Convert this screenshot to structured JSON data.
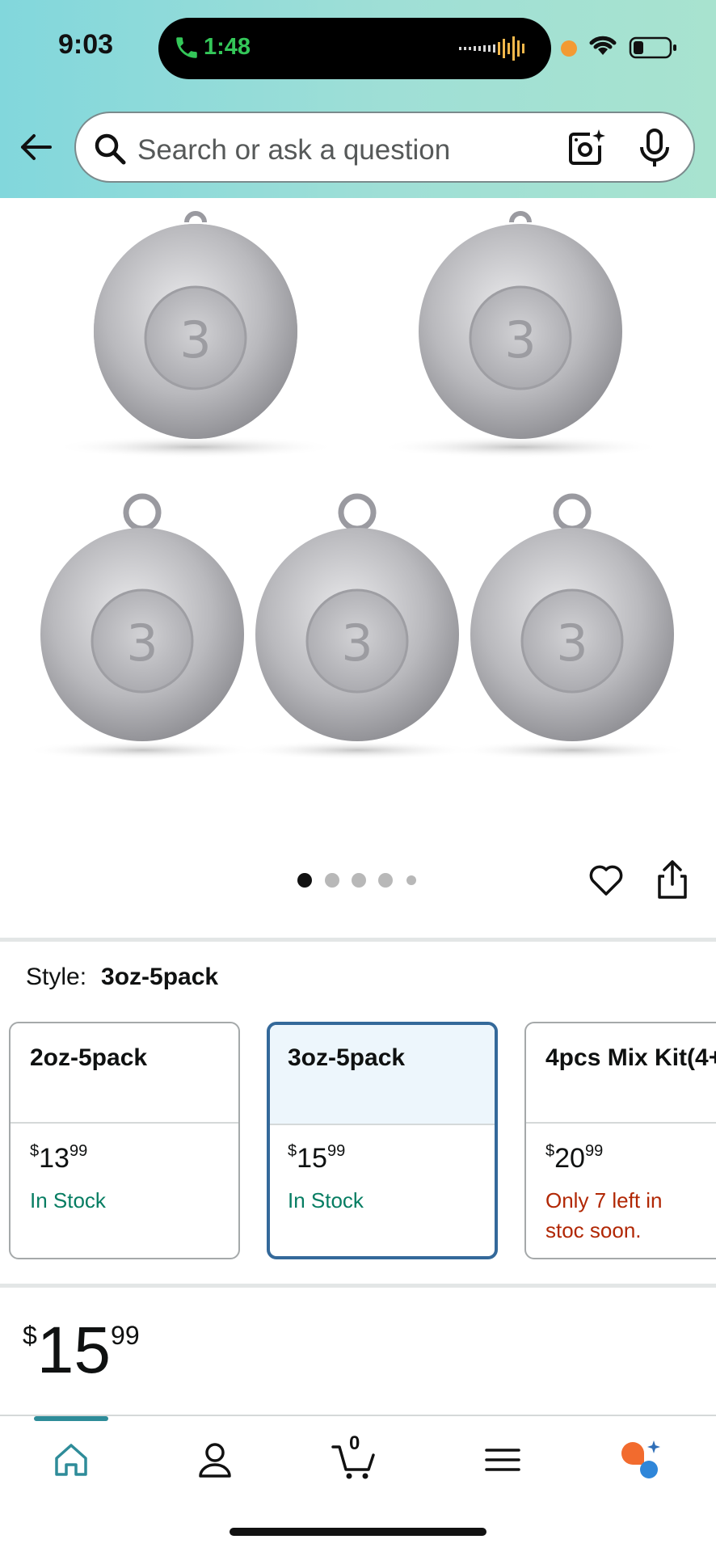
{
  "status_bar": {
    "time": "9:03",
    "call_duration": "1:48"
  },
  "header": {
    "search_placeholder": "Search or ask a question"
  },
  "product_image": {
    "weight_marking": "3",
    "carousel_count": 5,
    "carousel_active": 1
  },
  "style_selector": {
    "label": "Style:",
    "selected_value": "3oz-5pack",
    "options": [
      {
        "name": "2oz-5pack",
        "price_dollars": "13",
        "price_cents": "99",
        "currency": "$",
        "stock": "In Stock"
      },
      {
        "name": "3oz-5pack",
        "price_dollars": "15",
        "price_cents": "99",
        "currency": "$",
        "stock": "In Stock"
      },
      {
        "name": "4pcs Mix Kit(4+",
        "price_dollars": "20",
        "price_cents": "99",
        "currency": "$",
        "stock": "Only 7 left in stoc soon."
      }
    ]
  },
  "price": {
    "currency": "$",
    "dollars": "15",
    "cents": "99"
  },
  "bottom_nav": {
    "cart_count": "0",
    "items": [
      "home-icon",
      "account-icon",
      "cart-icon",
      "menu-icon",
      "rufus-assistant-icon"
    ]
  },
  "colors": {
    "header_gradient_start": "#82d7dc",
    "header_gradient_end": "#a8e3cf",
    "in_stock": "#067d62",
    "low_stock": "#b12704",
    "selected_border": "#34699a",
    "nav_accent": "#2e8c99"
  }
}
